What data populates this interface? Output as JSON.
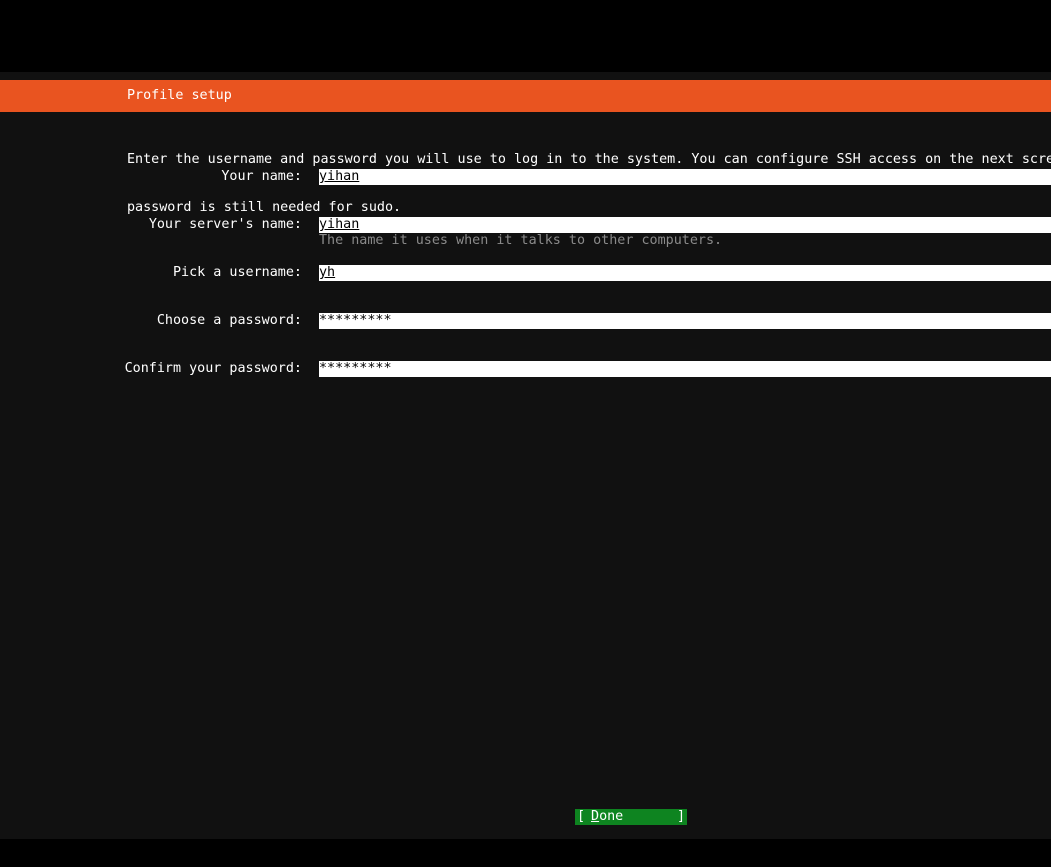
{
  "header": {
    "title": "Profile setup"
  },
  "intro": {
    "line1": "Enter the username and password you will use to log in to the system. You can configure SSH access on the next scree",
    "line2": "password is still needed for sudo."
  },
  "fields": [
    {
      "label": "Your name:",
      "value": "yihan"
    },
    {
      "label": "Your server's name:",
      "value": "yihan",
      "hint": "The name it uses when it talks to other computers."
    },
    {
      "label": "Pick a username:",
      "value": "yh"
    },
    {
      "label": "Choose a password:",
      "value": "*********"
    },
    {
      "label": "Confirm your password:",
      "value": "*********"
    }
  ],
  "footer": {
    "done_open": "[",
    "done_first": "D",
    "done_rest": "one",
    "done_close": "]"
  },
  "colors": {
    "header_bg": "#e95420",
    "screen_bg": "#111111",
    "button_bg": "#0e8420",
    "hint_text": "#8a8a8a"
  }
}
